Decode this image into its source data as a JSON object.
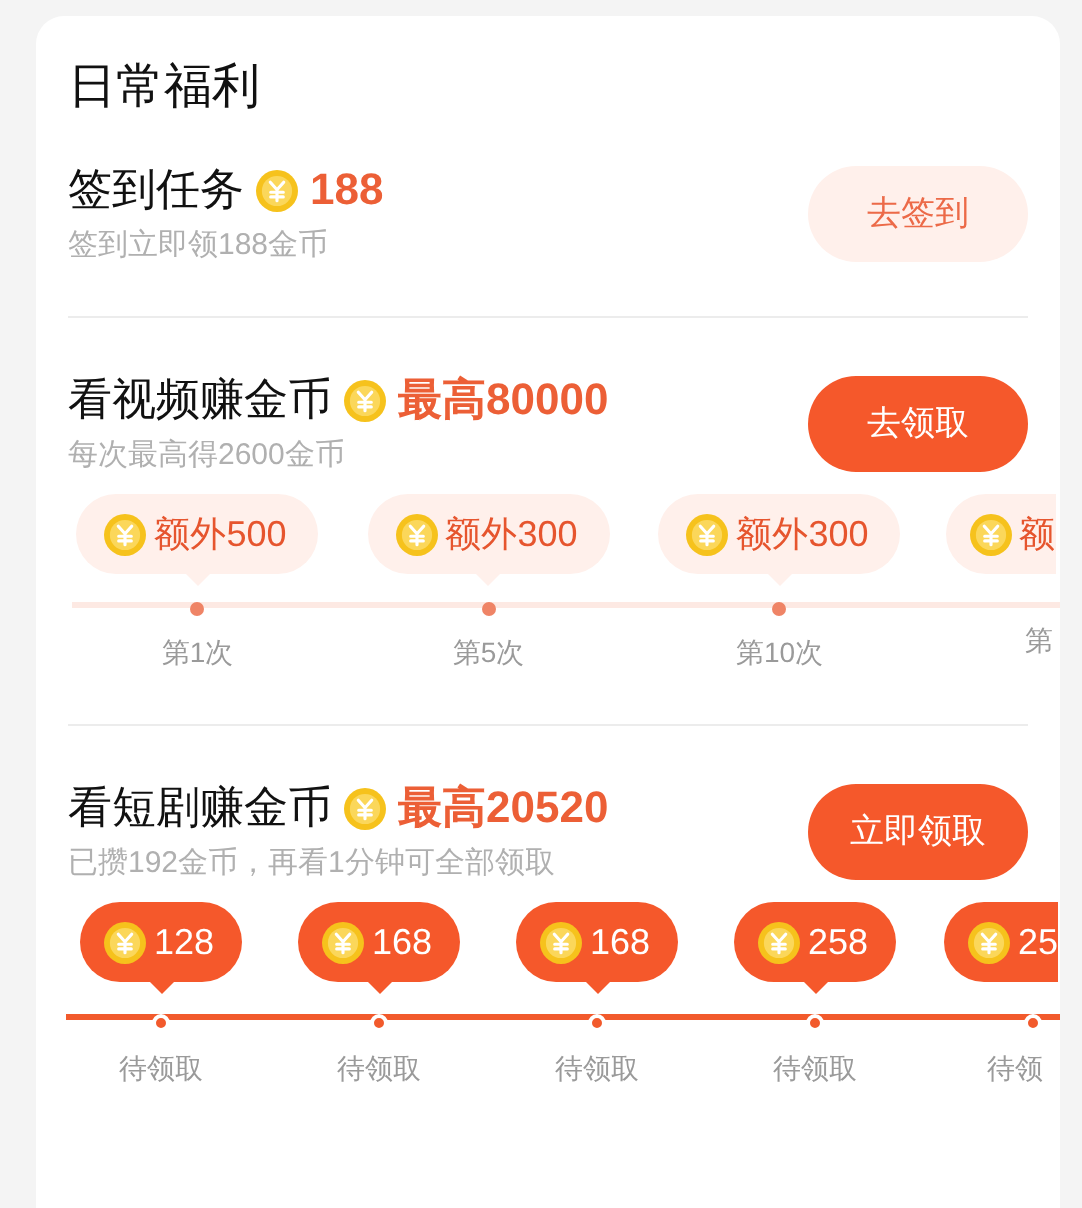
{
  "section_title": "日常福利",
  "tasks": [
    {
      "kind": "plain",
      "title": "签到任务",
      "reward": "188",
      "subtitle": "签到立即领188金币",
      "button": {
        "label": "去签到",
        "emphasis": false
      }
    },
    {
      "kind": "extra",
      "title": "看视频赚金币",
      "reward": "最高80000",
      "subtitle": "每次最高得2600金币",
      "button": {
        "label": "去领取",
        "emphasis": true
      },
      "milestones": [
        {
          "bubble": "额外500",
          "label": "第1次"
        },
        {
          "bubble": "额外300",
          "label": "第5次"
        },
        {
          "bubble": "额外300",
          "label": "第10次"
        },
        {
          "bubble": "额",
          "label": "第"
        }
      ]
    },
    {
      "kind": "pending",
      "title": "看短剧赚金币",
      "reward": "最高20520",
      "subtitle": "已攒192金币，再看1分钟可全部领取",
      "button": {
        "label": "立即领取",
        "emphasis": true
      },
      "milestones": [
        {
          "bubble": "128",
          "label": "待领取"
        },
        {
          "bubble": "168",
          "label": "待领取"
        },
        {
          "bubble": "168",
          "label": "待领取"
        },
        {
          "bubble": "258",
          "label": "待领取"
        },
        {
          "bubble": "25",
          "label": "待领"
        }
      ]
    }
  ]
}
